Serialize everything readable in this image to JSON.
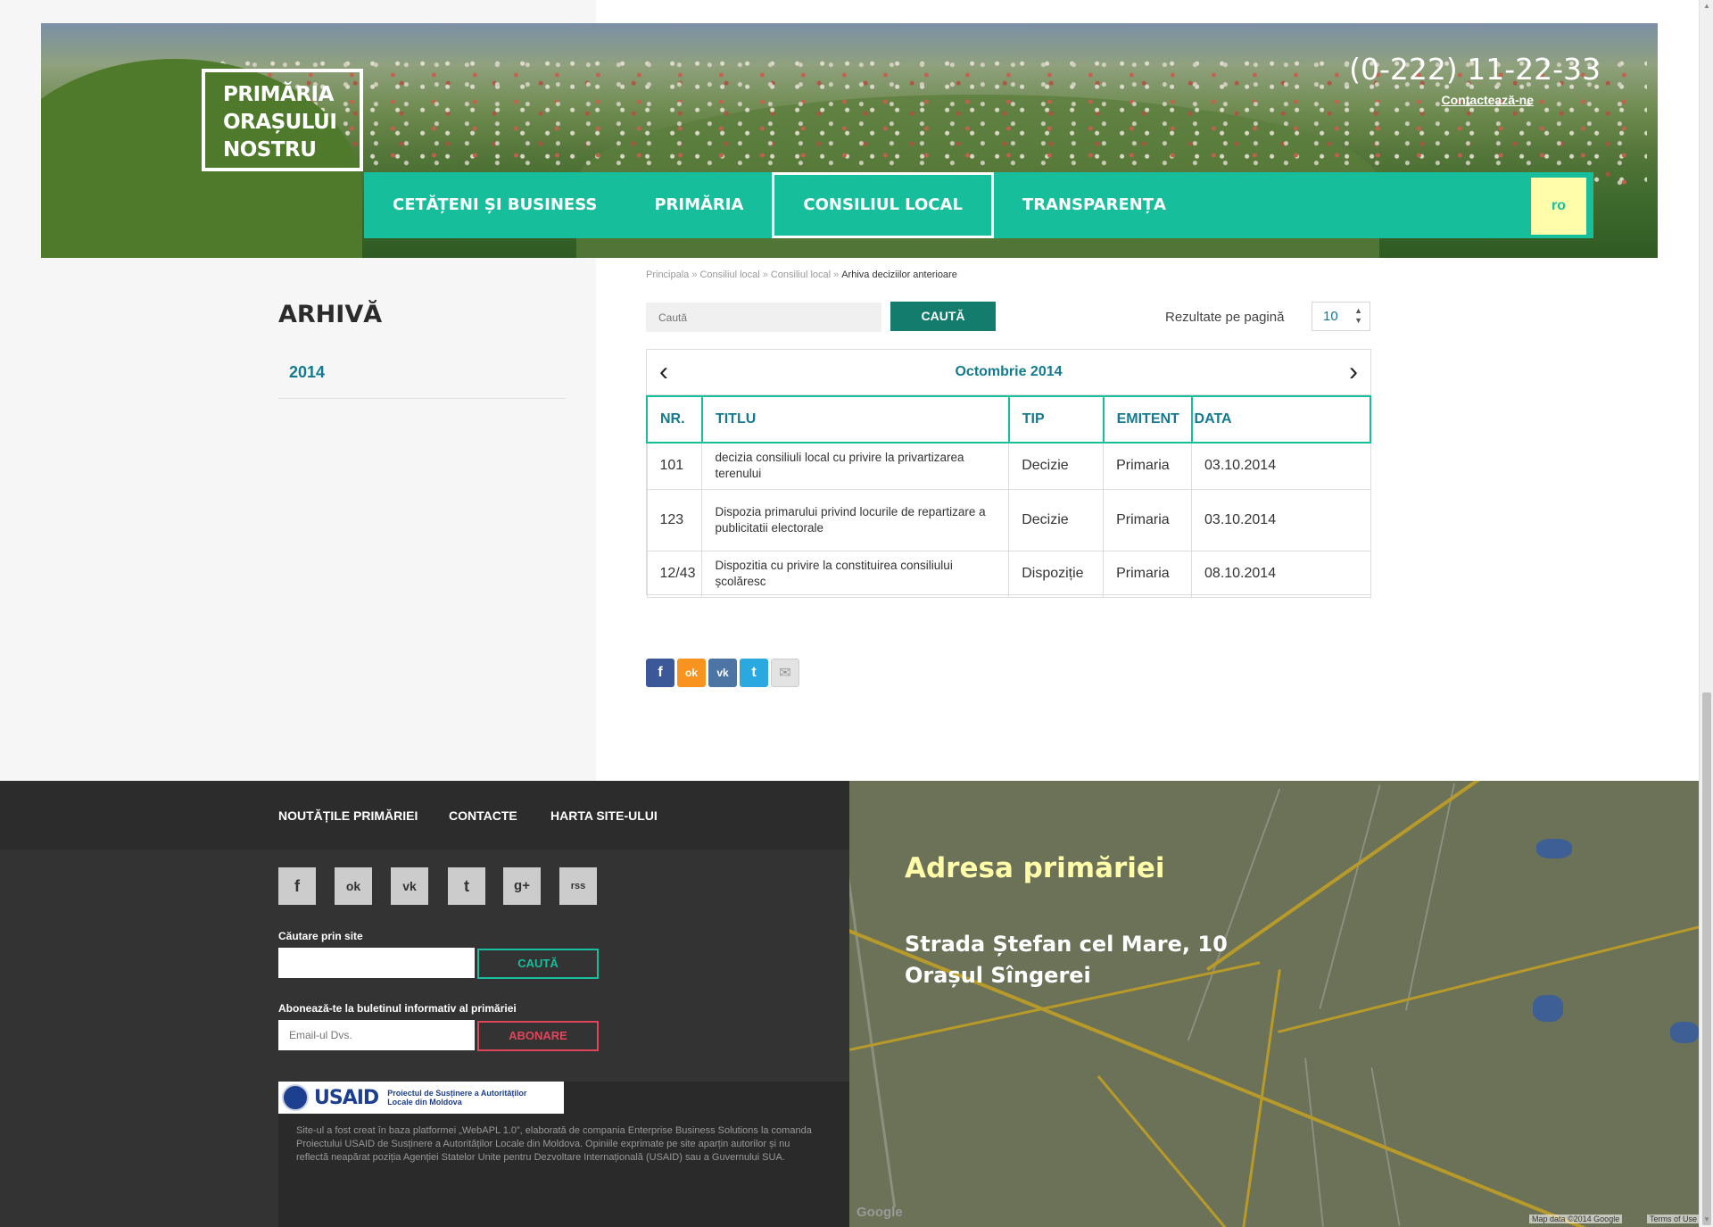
{
  "header": {
    "logo_lines": [
      "PRIMĂRIA",
      "ORAȘULUI",
      "NOSTRU"
    ],
    "phone": "(0-222) 11-22-33",
    "contact_link": "Contactează-ne",
    "nav": [
      "CETĂȚENI ȘI BUSINESS",
      "PRIMĂRIA",
      "CONSILIUL LOCAL",
      "TRANSPARENȚA"
    ],
    "active_nav_index": 2,
    "lang": "ro"
  },
  "sidebar": {
    "title": "ARHIVĂ",
    "years": [
      "2014"
    ]
  },
  "breadcrumb": [
    "Principala",
    "Consiliul local",
    "Consiliul local",
    "Arhiva deciziilor anterioare"
  ],
  "search": {
    "placeholder": "Caută",
    "button": "CAUTĂ",
    "per_page_label": "Rezultate pe pagină",
    "per_page_value": "10"
  },
  "table": {
    "month": "Octombrie 2014",
    "columns": [
      "NR.",
      "TITLU",
      "TIP",
      "EMITENT",
      "DATA"
    ],
    "rows": [
      [
        "101",
        "decizia consiliuli local cu privire la privartizarea terenului",
        "Decizie",
        "Primaria",
        "03.10.2014"
      ],
      [
        "123",
        "Dispozia primarului privind locurile de repartizare a publicitatii electorale",
        "Decizie",
        "Primaria",
        "03.10.2014"
      ],
      [
        "12/43",
        "Dispozitia cu privire la constituirea consiliului școlăresc",
        "Dispoziție",
        "Primaria",
        "08.10.2014"
      ]
    ]
  },
  "share": {
    "buttons": [
      {
        "name": "facebook-share-icon",
        "glyph": "f",
        "color": "#3b5998"
      },
      {
        "name": "odnoklassniki-share-icon",
        "glyph": "ok",
        "color": "#f7931e"
      },
      {
        "name": "vk-share-icon",
        "glyph": "vk",
        "color": "#4c75a3"
      },
      {
        "name": "twitter-share-icon",
        "glyph": "t",
        "color": "#2aa9e0"
      },
      {
        "name": "email-share-icon",
        "glyph": "✉",
        "color": "#e3e3e3"
      }
    ]
  },
  "footer": {
    "links": [
      "NOUTĂȚILE PRIMĂRIEI",
      "CONTACTE",
      "HARTA SITE-ULUI"
    ],
    "social": [
      {
        "name": "facebook-icon",
        "glyph": "f"
      },
      {
        "name": "odnoklassniki-icon",
        "glyph": "ok"
      },
      {
        "name": "vk-icon",
        "glyph": "vk"
      },
      {
        "name": "twitter-icon",
        "glyph": "t"
      },
      {
        "name": "google-plus-icon",
        "glyph": "g+"
      },
      {
        "name": "rss-icon",
        "glyph": "rss"
      }
    ],
    "search_label": "Căutare prin site",
    "search_button": "CAUTĂ",
    "newsletter_label": "Abonează-te la buletinul informativ al primăriei",
    "email_placeholder": "Email-ul Dvs.",
    "subscribe_button": "ABONARE",
    "usaid_word": "USAID",
    "usaid_project": "Proiectul de Susținere a Autorităților Locale din Moldova",
    "note": "Site-ul a fost creat în baza platformei „WebAPL 1.0”, elaborată de compania Enterprise Business Solutions la comanda Proiectului USAID de Susținere a Autorităților Locale din Moldova. Opiniile exprimate pe site aparțin autorilor și nu reflectă neapărat poziția Agenției Statelor Unite pentru Dezvoltare Internațională (USAID) sau a Guvernului SUA."
  },
  "map": {
    "title": "Adresa primăriei",
    "address_line1": "Strada Ștefan cel Mare, 10",
    "address_line2": "Orașul Sîngerei",
    "credits": "Map data ©2014 Google",
    "terms": "Terms of Use",
    "google": "Google"
  },
  "colors": {
    "accent": "#17be9c",
    "accent_dark": "#137a8f",
    "highlight": "#fffcaa",
    "danger": "#e0455c"
  }
}
